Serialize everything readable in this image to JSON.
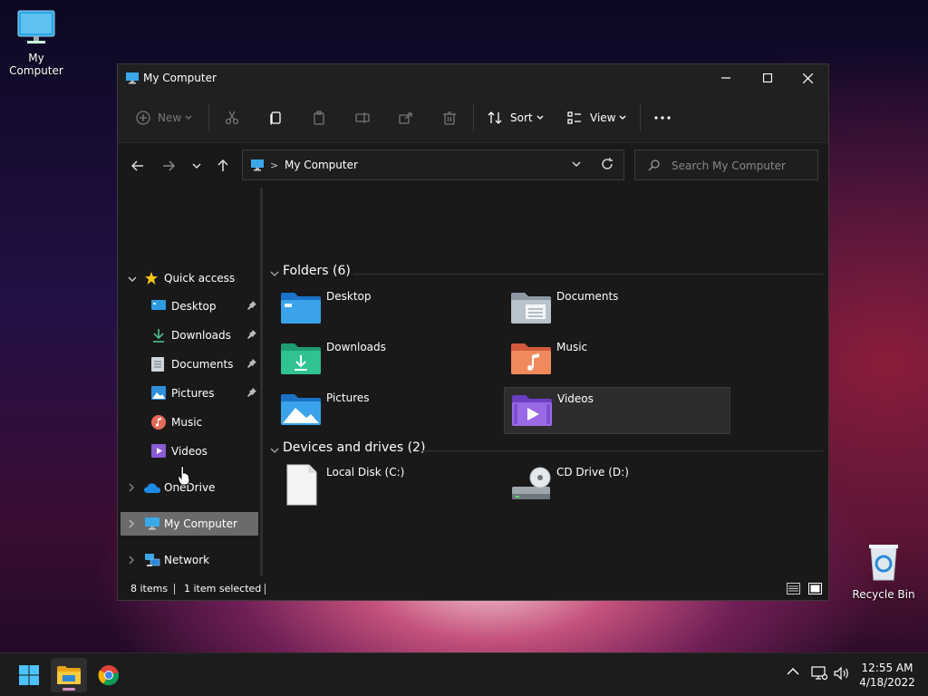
{
  "desktop": {
    "my_computer_label": "My Computer",
    "recycle_bin_label": "Recycle Bin"
  },
  "window": {
    "title": "My Computer",
    "controls": {
      "minimize": "minimize",
      "maximize": "maximize",
      "close": "close"
    }
  },
  "commandbar": {
    "new_label": "New",
    "sort_label": "Sort",
    "view_label": "View",
    "icons": [
      "cut-icon",
      "copy-icon",
      "paste-icon",
      "rename-icon",
      "share-icon",
      "delete-icon",
      "more-icon"
    ]
  },
  "navbar": {
    "address": "My Computer",
    "separator": ">",
    "search_placeholder": "Search My Computer"
  },
  "sidebar": {
    "quick_access": "Quick access",
    "items": [
      {
        "label": "Desktop",
        "icon": "desktop-icon",
        "pinned": true
      },
      {
        "label": "Downloads",
        "icon": "downloads-icon",
        "pinned": true
      },
      {
        "label": "Documents",
        "icon": "documents-icon",
        "pinned": true
      },
      {
        "label": "Pictures",
        "icon": "pictures-icon",
        "pinned": true
      },
      {
        "label": "Music",
        "icon": "music-icon",
        "pinned": false
      },
      {
        "label": "Videos",
        "icon": "videos-icon",
        "pinned": false
      }
    ],
    "onedrive": "OneDrive",
    "my_computer": "My Computer",
    "network": "Network"
  },
  "content": {
    "folders_header": "Folders (6)",
    "folders": [
      {
        "label": "Desktop",
        "icon": "desktop-folder-icon"
      },
      {
        "label": "Documents",
        "icon": "documents-folder-icon"
      },
      {
        "label": "Downloads",
        "icon": "downloads-folder-icon"
      },
      {
        "label": "Music",
        "icon": "music-folder-icon"
      },
      {
        "label": "Pictures",
        "icon": "pictures-folder-icon"
      },
      {
        "label": "Videos",
        "icon": "videos-folder-icon",
        "selected": true
      }
    ],
    "devices_header": "Devices and drives (2)",
    "devices": [
      {
        "label": "Local Disk (C:)",
        "icon": "disk-icon"
      },
      {
        "label": "CD Drive (D:)",
        "icon": "cd-drive-icon"
      }
    ]
  },
  "statusbar": {
    "items_count": "8 items",
    "selected_count": "1 item selected"
  },
  "taskbar": {
    "time": "12:55 AM",
    "date": "4/18/2022",
    "apps": [
      "start-icon",
      "file-explorer-icon",
      "chrome-icon"
    ]
  },
  "colors": {
    "window_bg": "#191919",
    "titlebar_bg": "#202020",
    "selected_bg": "#6b6b6b",
    "accent_blue": "#3d9ae8"
  }
}
